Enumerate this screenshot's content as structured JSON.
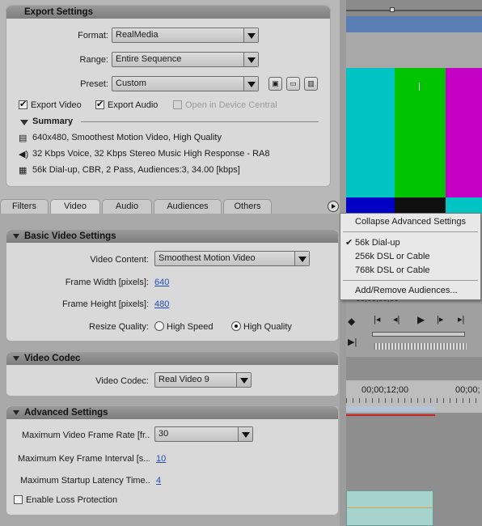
{
  "export_settings": {
    "title": "Export Settings",
    "format_label": "Format:",
    "format_value": "RealMedia",
    "range_label": "Range:",
    "range_value": "Entire Sequence",
    "preset_label": "Preset:",
    "preset_value": "Custom",
    "export_video": "Export Video",
    "export_audio": "Export Audio",
    "open_device_central": "Open in Device Central",
    "summary_title": "Summary",
    "summary_video": "640x480, Smoothest Motion Video, High Quality",
    "summary_audio": "32 Kbps Voice, 32 Kbps Stereo Music High Response - RA8",
    "summary_audience": "56k Dial-up, CBR, 2 Pass, Audiences:3, 34.00 [kbps]"
  },
  "tabs": [
    "Filters",
    "Video",
    "Audio",
    "Audiences",
    "Others"
  ],
  "basic_video": {
    "title": "Basic Video Settings",
    "content_label": "Video Content:",
    "content_value": "Smoothest Motion Video",
    "width_label": "Frame Width [pixels]:",
    "width_value": "640",
    "height_label": "Frame Height [pixels]:",
    "height_value": "480",
    "resize_label": "Resize Quality:",
    "resize_high_speed": "High Speed",
    "resize_high_quality": "High Quality"
  },
  "video_codec": {
    "title": "Video Codec",
    "codec_label": "Video Codec:",
    "codec_value": "Real Video 9"
  },
  "advanced": {
    "title": "Advanced Settings",
    "max_fps_label": "Maximum Video Frame Rate [fr...",
    "max_fps_value": "30",
    "keyframe_label": "Maximum Key Frame Interval [s...",
    "keyframe_value": "10",
    "latency_label": "Maximum Startup Latency Time...",
    "latency_value": "4",
    "loss_protection": "Enable Loss Protection"
  },
  "menu": {
    "collapse": "Collapse Advanced Settings",
    "dialup": "56k Dial-up",
    "dsl256": "256k DSL or Cable",
    "dsl768": "768k DSL or Cable",
    "add_remove": "Add/Remove Audiences..."
  },
  "timeline": {
    "tc1": "00;00;12;00",
    "tc2": "00;00;"
  },
  "colors": {
    "bar_cyan": "#00c4c4",
    "bar_green": "#00c400",
    "bar_magenta": "#c400c4",
    "bar_blue": "#0000c4",
    "bar_black": "#101010"
  }
}
